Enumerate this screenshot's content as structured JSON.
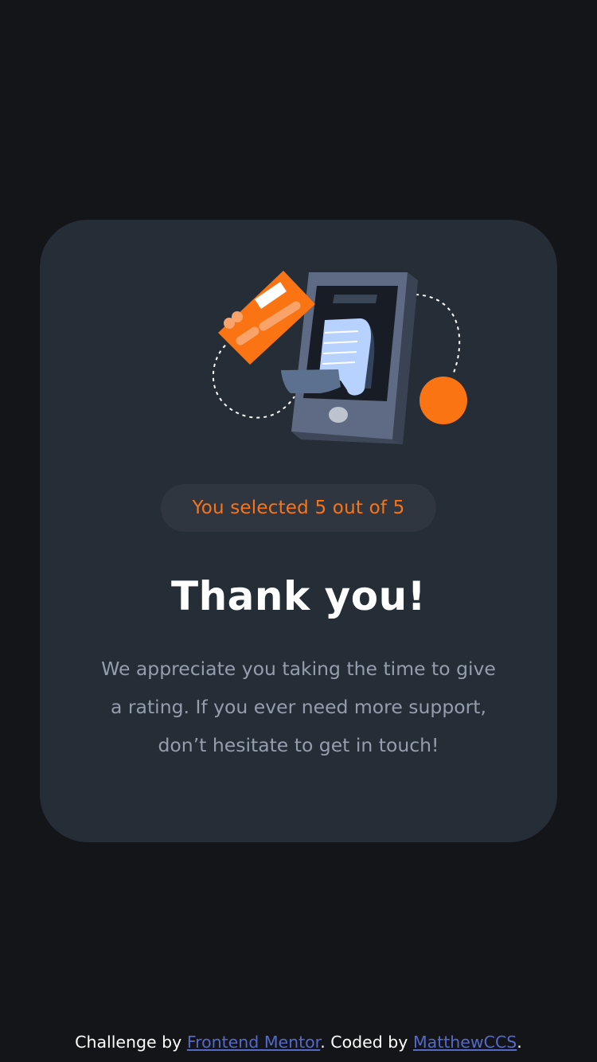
{
  "colors": {
    "page_background": "#131518",
    "card_background": "#252d37",
    "accent_orange": "#fb7413",
    "muted_text": "#959eac",
    "link": "#5569c9"
  },
  "illustration": {
    "icon": "phone-payment-receipt-illustration"
  },
  "selection_badge": {
    "text": "You selected 5 out of 5",
    "selected": 5,
    "max": 5
  },
  "title": "Thank you!",
  "message": "We appreciate you taking the time to give a rating. If you ever need more support, don’t hesitate to get in touch!",
  "footer": {
    "challenge_prefix": "Challenge by ",
    "challenge_link": "Frontend Mentor",
    "coded_prefix": ". Coded by ",
    "author_link": "MatthewCCS",
    "suffix": "."
  }
}
